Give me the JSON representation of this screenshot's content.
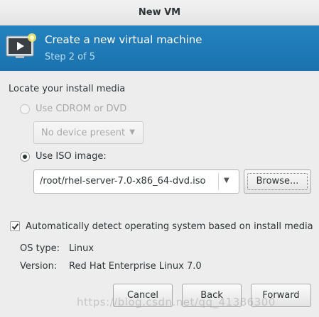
{
  "window": {
    "title": "New VM"
  },
  "banner": {
    "title": "Create a new virtual machine",
    "step": "Step 2 of 5",
    "icon": "monitor-new-vm-icon",
    "accent_color": "#1e7bb8"
  },
  "install_media": {
    "section_label": "Locate your install media",
    "cdrom_option": {
      "label": "Use CDROM or DVD",
      "selected": false,
      "enabled": false
    },
    "cdrom_device": {
      "value": "No device present",
      "enabled": false
    },
    "iso_option": {
      "label": "Use ISO image:",
      "selected": true,
      "enabled": true
    },
    "iso_path": {
      "value": "/root/rhel-server-7.0-x86_64-dvd.iso"
    },
    "browse_label": "Browse..."
  },
  "os_detection": {
    "auto_detect_label": "Automatically detect operating system based on install media",
    "auto_detect_checked": true,
    "os_type_label": "OS type:",
    "os_type_value": "Linux",
    "version_label": "Version:",
    "version_value": "Red Hat Enterprise Linux 7.0"
  },
  "footer": {
    "cancel_label": "Cancel",
    "back_label": "Back",
    "forward_label": "Forward"
  },
  "watermark": "https://blog.csdn.net/qq_41386300"
}
